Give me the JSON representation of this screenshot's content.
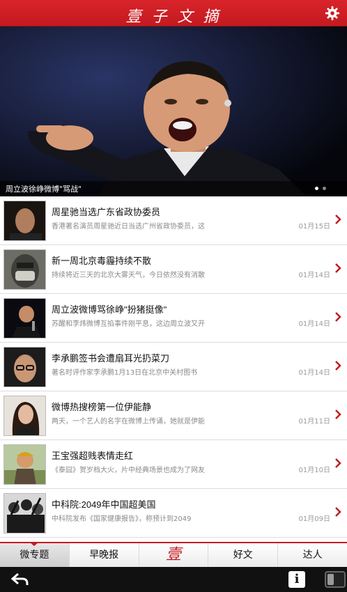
{
  "header": {
    "title": "壹 子 文 摘",
    "settings_icon": "gear-icon"
  },
  "hero": {
    "caption": "周立波徐峥微博\"骂战\"",
    "slide_count": 2,
    "active_slide": 1
  },
  "articles": [
    {
      "title": "周星驰当选广东省政协委员",
      "summary": "香港著名演员周星驰近日当选广州省政协委员，这",
      "date": "01月15日",
      "thumb": "portrait-dark"
    },
    {
      "title": "新一周北京毒霾持续不散",
      "summary": "持续将近三天的北京大雾天气，今日依然没有消散",
      "date": "01月14日",
      "thumb": "masked-face"
    },
    {
      "title": "周立波微博骂徐峥\"扮猪挺像\"",
      "summary": "苏醒和李炜微博互掐事件刚平息，这边周立波又开",
      "date": "01月14日",
      "thumb": "man-microphone"
    },
    {
      "title": "李承鹏签书会遭扇耳光扔菜刀",
      "summary": "著名时评作家李承鹏1月13日在北京中关村图书",
      "date": "01月14日",
      "thumb": "man-glasses"
    },
    {
      "title": "微博热搜榜第一位伊能静",
      "summary": "两天，一个艺人的名字在微博上传诵，她就是伊能",
      "date": "01月11日",
      "thumb": "woman-portrait"
    },
    {
      "title": "王宝强超贱表情走红",
      "summary": "《泰囧》贺岁档大火，片中经典场景也成为了网友",
      "date": "01月10日",
      "thumb": "man-outdoor"
    },
    {
      "title": "中科院:2049年中国超美国",
      "summary": "中科院发布《国家健康报告》，称预计到2049",
      "date": "01月09日",
      "thumb": "crowd-bw"
    }
  ],
  "tabs": [
    {
      "label": "微专题",
      "active": true
    },
    {
      "label": "早晚报",
      "active": false
    },
    {
      "label": "壹",
      "active": false,
      "is_logo": true
    },
    {
      "label": "好文",
      "active": false
    },
    {
      "label": "达人",
      "active": false
    }
  ],
  "system_bar": {
    "back_icon": "back-arrow-icon",
    "info_label": "i",
    "toggle_icon": "toggle-icon"
  },
  "colors": {
    "brand_red": "#c41a20",
    "text_dark": "#111111",
    "text_muted": "#8a8a8a"
  }
}
